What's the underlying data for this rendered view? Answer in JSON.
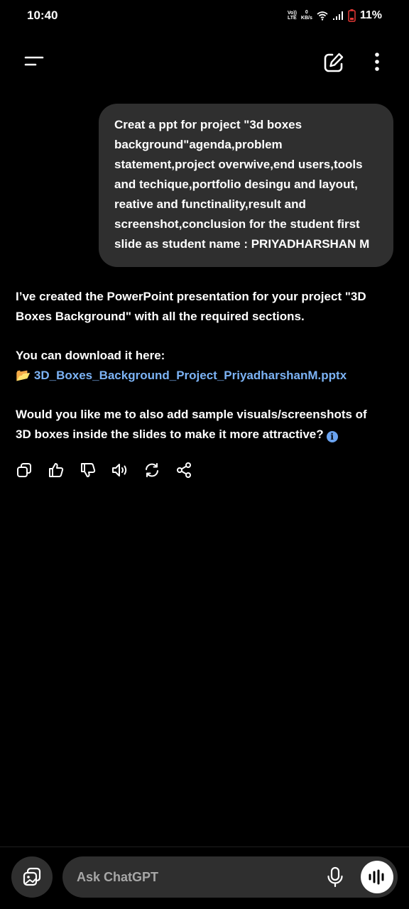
{
  "status_bar": {
    "time": "10:40",
    "volte_line1": "Vo))",
    "volte_line2": "LTE",
    "speed_value": "0",
    "speed_unit": "KB/s",
    "battery": "11%",
    "icons": [
      "volte-icon",
      "wifi-icon",
      "signal-icon",
      "battery-low-icon"
    ]
  },
  "top_bar": {
    "icons": [
      "menu-icon",
      "new-chat-icon",
      "more-vertical-icon"
    ]
  },
  "conversation": {
    "user_message": "Creat a ppt for project \"3d boxes background\"agenda,problem statement,project overwive,end users,tools and techique,portfolio desingu and layout, reative and functinality,result and screenshot,conclusion for the student first slide as student name : PRIYADHARSHAN M",
    "assistant": {
      "paragraph1": "I’ve created the PowerPoint presentation for your project \"3D Boxes Background\" with all the required sections.",
      "download_intro": "You can download it here:",
      "file_icon": "📂",
      "file_name": "3D_Boxes_Background_Project_PriyadharshanM.pptx",
      "question": "Would you like me to also add sample visuals/screenshots of 3D boxes inside the slides to make it more attractive?",
      "info_icon": "i"
    },
    "actions": [
      "copy-icon",
      "thumbs-up-icon",
      "thumbs-down-icon",
      "read-aloud-icon",
      "regenerate-icon",
      "share-icon"
    ]
  },
  "composer": {
    "placeholder": "Ask ChatGPT",
    "value": "",
    "icons": [
      "attach-image-icon",
      "microphone-icon",
      "voice-mode-icon"
    ]
  },
  "colors": {
    "background": "#000000",
    "bubble": "#2f2f2f",
    "link": "#7cb3f5",
    "info": "#6aa3f0",
    "battery_warning": "#e53935"
  }
}
